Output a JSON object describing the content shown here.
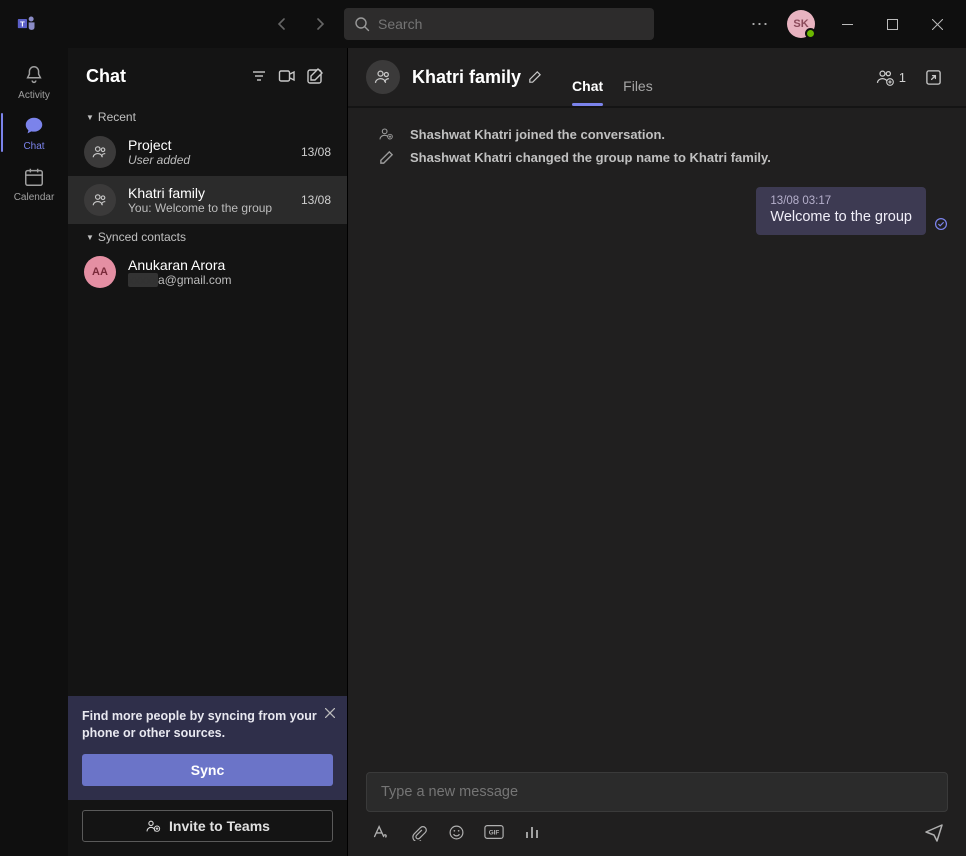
{
  "titlebar": {
    "search_placeholder": "Search",
    "avatar_initials": "SK"
  },
  "rail": {
    "activity": "Activity",
    "chat": "Chat",
    "calendar": "Calendar"
  },
  "listpanel": {
    "title": "Chat",
    "section_recent": "Recent",
    "section_synced": "Synced contacts",
    "chats": [
      {
        "name": "Project",
        "sub": "User added",
        "date": "13/08",
        "active": false
      },
      {
        "name": "Khatri family",
        "sub": "You: Welcome to the group",
        "date": "13/08",
        "active": true
      }
    ],
    "synced": [
      {
        "initials": "AA",
        "name": "Anukaran Arora",
        "email": "a@gmail.com"
      }
    ],
    "promo_text": "Find more people by syncing from your phone or other sources.",
    "sync_label": "Sync",
    "invite_label": "Invite to Teams"
  },
  "conv": {
    "title": "Khatri family",
    "tab_chat": "Chat",
    "tab_files": "Files",
    "participant_count": "1",
    "sys1": "Shashwat Khatri joined the conversation.",
    "sys2": "Shashwat Khatri changed the group name to Khatri family.",
    "msg_time": "13/08 03:17",
    "msg_text": "Welcome to the group",
    "compose_placeholder": "Type a new message"
  }
}
